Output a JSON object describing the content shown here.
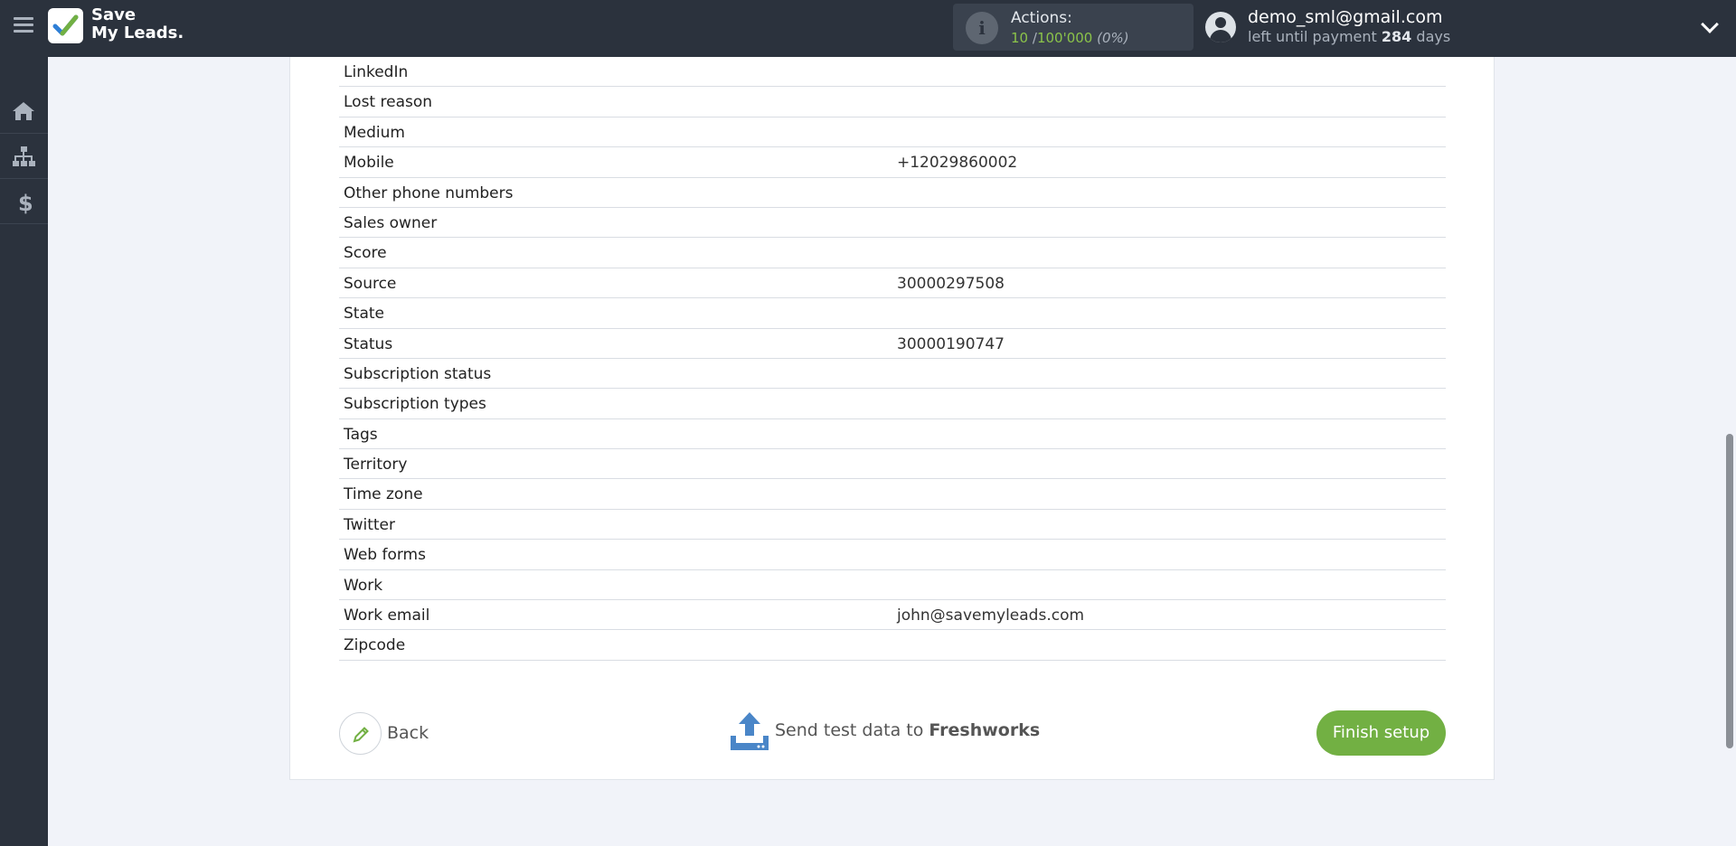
{
  "app": {
    "logo_line1": "Save",
    "logo_line2": "My Leads."
  },
  "actions": {
    "label": "Actions:",
    "used": "10",
    "separator": "/",
    "limit": "100'000",
    "percent": "(0%)"
  },
  "user": {
    "email": "demo_sml@gmail.com",
    "payment_prefix": "left until payment",
    "days": "284",
    "payment_suffix": "days"
  },
  "fields": [
    {
      "key": "LinkedIn",
      "value": ""
    },
    {
      "key": "Lost reason",
      "value": ""
    },
    {
      "key": "Medium",
      "value": ""
    },
    {
      "key": "Mobile",
      "value": "+12029860002"
    },
    {
      "key": "Other phone numbers",
      "value": ""
    },
    {
      "key": "Sales owner",
      "value": ""
    },
    {
      "key": "Score",
      "value": ""
    },
    {
      "key": "Source",
      "value": "30000297508"
    },
    {
      "key": "State",
      "value": ""
    },
    {
      "key": "Status",
      "value": "30000190747"
    },
    {
      "key": "Subscription status",
      "value": ""
    },
    {
      "key": "Subscription types",
      "value": ""
    },
    {
      "key": "Tags",
      "value": ""
    },
    {
      "key": "Territory",
      "value": ""
    },
    {
      "key": "Time zone",
      "value": ""
    },
    {
      "key": "Twitter",
      "value": ""
    },
    {
      "key": "Web forms",
      "value": ""
    },
    {
      "key": "Work",
      "value": ""
    },
    {
      "key": "Work email",
      "value": "john@savemyleads.com"
    },
    {
      "key": "Zipcode",
      "value": ""
    }
  ],
  "footer": {
    "back_label": "Back",
    "send_prefix": "Send test data to",
    "send_target": "Freshworks",
    "finish_label": "Finish setup"
  },
  "colors": {
    "topbar": "#2b323d",
    "accent_green": "#72b043",
    "actions_green": "#8bc34a",
    "send_icon_blue": "#4a86c8"
  },
  "icons": {
    "sidebar": [
      "home-icon",
      "sitemap-icon",
      "dollar-icon"
    ],
    "back": "pencil-icon",
    "send": "upload-tray-icon",
    "info": "info-icon",
    "user": "user-circle-icon",
    "menu": "hamburger-icon",
    "dropdown": "chevron-down-icon"
  }
}
